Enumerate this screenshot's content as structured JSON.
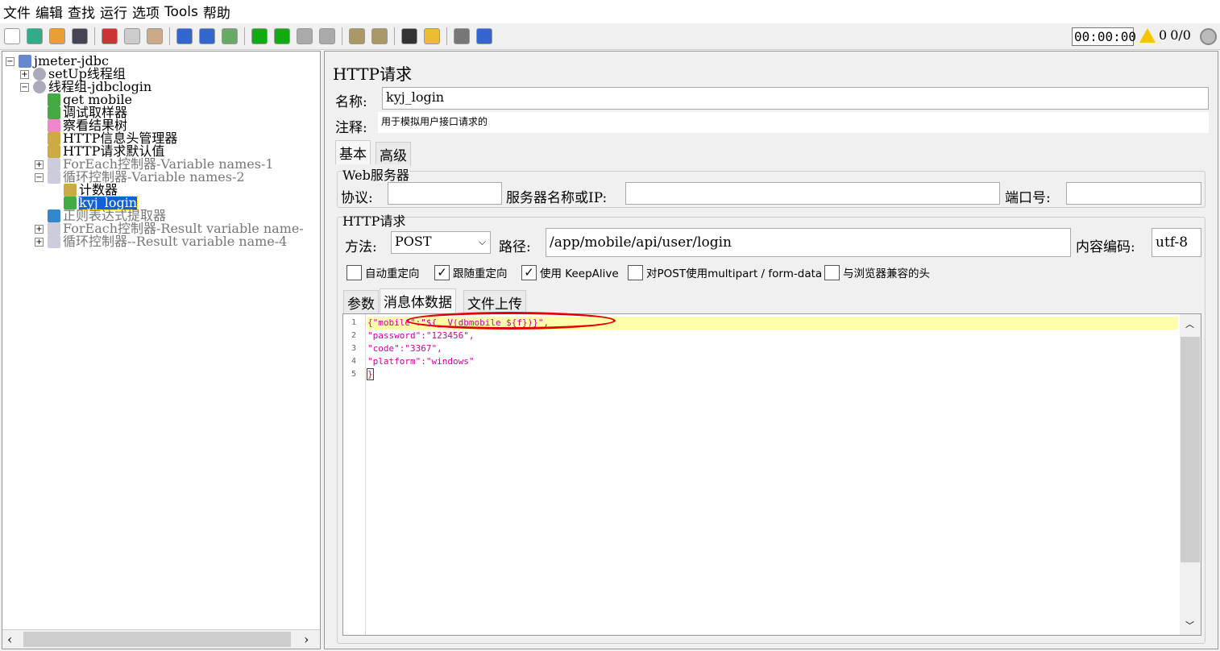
{
  "menu": [
    "文件",
    "编辑",
    "查找",
    "运行",
    "选项",
    "Tools",
    "帮助"
  ],
  "toolbar": {
    "icons": [
      "new-icon",
      "templates-icon",
      "open-icon",
      "save-icon",
      "cut-icon",
      "copy-icon",
      "paste-icon",
      "expand-icon",
      "collapse-icon",
      "toggle-icon",
      "start-icon",
      "start-no-pause-icon",
      "stop-icon",
      "shutdown-icon",
      "clear-icon",
      "clear-all-icon",
      "search-icon",
      "reset-search-icon",
      "function-helper-icon",
      "help-icon"
    ],
    "timer": "00:00:00",
    "warnings": "0",
    "threads": "0/0"
  },
  "tree": [
    {
      "label": "jmeter-jdbc",
      "icon": "test-plan-icon"
    },
    {
      "label": "setUp线程组",
      "icon": "gear-icon"
    },
    {
      "label": "线程组-jdbclogin",
      "icon": "gear-icon"
    },
    {
      "label": "get mobile",
      "icon": "sampler-icon"
    },
    {
      "label": "调试取样器",
      "icon": "sampler-icon"
    },
    {
      "label": "察看结果树",
      "icon": "listener-icon"
    },
    {
      "label": "HTTP信息头管理器",
      "icon": "config-icon"
    },
    {
      "label": "HTTP请求默认值",
      "icon": "config-icon"
    },
    {
      "label": "ForEach控制器-Variable names-1",
      "icon": "controller-icon"
    },
    {
      "label": "循环控制器-Variable names-2",
      "icon": "controller-icon"
    },
    {
      "label": "计数器",
      "icon": "config-icon"
    },
    {
      "label": "kyj_login",
      "icon": "sampler-icon"
    },
    {
      "label": "正则表达式提取器",
      "icon": "extractor-icon"
    },
    {
      "label": "ForEach控制器-Result variable name-",
      "icon": "controller-icon"
    },
    {
      "label": "循环控制器--Result variable name-4",
      "icon": "controller-icon"
    }
  ],
  "panel": {
    "title": "HTTP请求",
    "name_label": "名称:",
    "name_value": "kyj_login",
    "comment_label": "注释:",
    "comment_value": "用于模拟用户接口请求的",
    "tabs": [
      "基本",
      "高级"
    ],
    "web_server": {
      "legend": "Web服务器",
      "protocol_label": "协议:",
      "protocol": "",
      "server_label": "服务器名称或IP:",
      "server": "",
      "port_label": "端口号:",
      "port": ""
    },
    "http": {
      "legend": "HTTP请求",
      "method_label": "方法:",
      "method": "POST",
      "path_label": "路径:",
      "path": "/app/mobile/api/user/login",
      "encoding_label": "内容编码:",
      "encoding": "utf-8"
    },
    "checkboxes": [
      {
        "label": "自动重定向",
        "checked": false
      },
      {
        "label": "跟随重定向",
        "checked": true
      },
      {
        "label": "使用 KeepAlive",
        "checked": true
      },
      {
        "label": "对POST使用multipart / form-data",
        "checked": false
      },
      {
        "label": "与浏览器兼容的头",
        "checked": false
      }
    ],
    "body_tabs": [
      "参数",
      "消息体数据",
      "文件上传"
    ],
    "body_lines": [
      "{\"mobile\":\"${__V(dbmobile_${f})}\",",
      "\"password\":\"123456\",",
      "\"code\":\"3367\",",
      "\"platform\":\"windows\"",
      "}"
    ],
    "line_numbers": [
      "1",
      "2",
      "3",
      "4",
      "5"
    ]
  },
  "colors": {
    "selection": "#1060d8",
    "code": "#d000a0",
    "highlight": "#ffffaa",
    "annotation": "#e00000"
  }
}
